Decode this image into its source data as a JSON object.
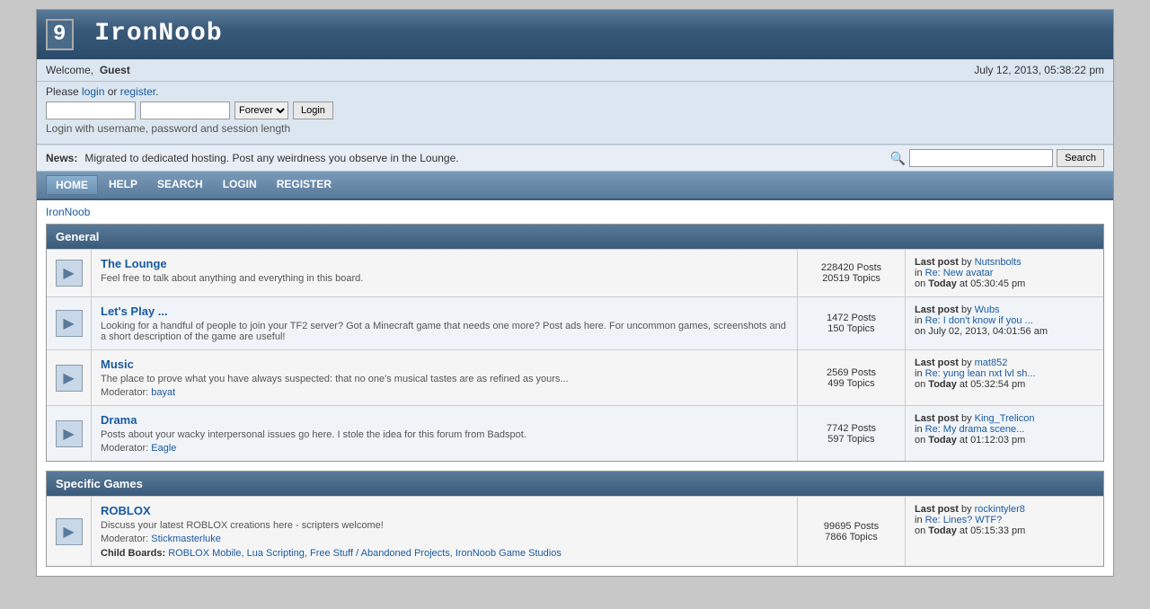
{
  "site": {
    "logo": "IronNoob",
    "logo_icon": "9",
    "breadcrumb": "IronNoob"
  },
  "welcome": {
    "prefix": "Welcome,",
    "user": "Guest",
    "datetime": "July 12, 2013, 05:38:22 pm"
  },
  "login": {
    "hint_before": "Please",
    "login_link": "login",
    "or": "or",
    "register_link": "register",
    "hint_suffix": ".",
    "forever_option": "Forever",
    "login_button": "Login",
    "session_hint": "Login with username, password and session length"
  },
  "news": {
    "label": "News:",
    "text": "Migrated to dedicated hosting. Post any weirdness you observe in the Lounge."
  },
  "search": {
    "button_label": "Search",
    "placeholder": ""
  },
  "nav": {
    "items": [
      {
        "label": "HOME",
        "active": true
      },
      {
        "label": "HELP",
        "active": false
      },
      {
        "label": "SEARCH",
        "active": false
      },
      {
        "label": "LOGIN",
        "active": false
      },
      {
        "label": "REGISTER",
        "active": false
      }
    ]
  },
  "sections": [
    {
      "title": "General",
      "forums": [
        {
          "name": "The Lounge",
          "description": "Feel free to talk about anything and everything in this board.",
          "moderator": null,
          "posts": "228420 Posts",
          "topics": "20519 Topics",
          "last_post_by": "Nutsnbolts",
          "last_post_in": "Re: New avatar",
          "last_post_on": "Today",
          "last_post_time": "at 05:30:45 pm",
          "child_boards": null
        },
        {
          "name": "Let's Play ...",
          "description": "Looking for a handful of people to join your TF2 server? Got a Minecraft game that needs one more? Post ads here. For uncommon games, screenshots and a short description of the game are useful!",
          "moderator": null,
          "posts": "1472 Posts",
          "topics": "150 Topics",
          "last_post_by": "Wubs",
          "last_post_in": "Re: I don't know if you ...",
          "last_post_on": "on July 02, 2013,",
          "last_post_time": "04:01:56 am",
          "child_boards": null
        },
        {
          "name": "Music",
          "description": "The place to prove what you have always suspected: that no one's musical tastes are as refined as yours...",
          "moderator": "bayat",
          "posts": "2569 Posts",
          "topics": "499 Topics",
          "last_post_by": "mat852",
          "last_post_in": "Re: yung lean nxt lvl sh...",
          "last_post_on": "Today",
          "last_post_time": "at 05:32:54 pm",
          "child_boards": null
        },
        {
          "name": "Drama",
          "description": "Posts about your wacky interpersonal issues go here. I stole the idea for this forum from Badspot.",
          "moderator": "Eagle",
          "posts": "7742 Posts",
          "topics": "597 Topics",
          "last_post_by": "King_Trelicon",
          "last_post_in": "Re: My drama scene...",
          "last_post_on": "Today",
          "last_post_time": "at 01:12:03 pm",
          "child_boards": null
        }
      ]
    },
    {
      "title": "Specific Games",
      "forums": [
        {
          "name": "ROBLOX",
          "description": "Discuss your latest ROBLOX creations here - scripters welcome!",
          "moderator": "Stickmasterluke",
          "posts": "99695 Posts",
          "topics": "7866 Topics",
          "last_post_by": "rockintyler8",
          "last_post_in": "Re: Lines? WTF?",
          "last_post_on": "Today",
          "last_post_time": "at 05:15:33 pm",
          "child_boards": [
            "ROBLOX Mobile",
            "Lua Scripting",
            "Free Stuff / Abandoned Projects",
            "IronNoob Game Studios"
          ]
        }
      ]
    }
  ]
}
